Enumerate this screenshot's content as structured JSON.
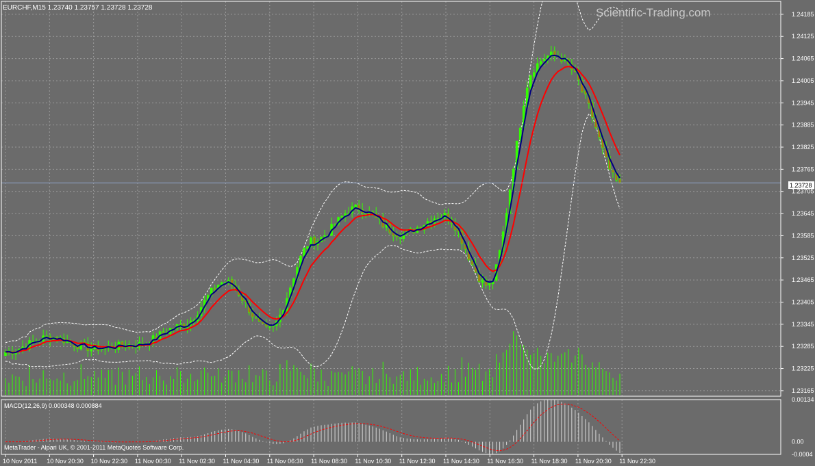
{
  "header": {
    "symbol_info": "EURCHF,M15  1.23740 1.23757 1.23728 1.23728",
    "watermark": "Scientific-Trading.com"
  },
  "macd": {
    "label": "MACD(12,26,9) 0.000348 0.000884"
  },
  "footer": {
    "copyright": "MetaTrader - Alpari UK, © 2001-2011 MetaQuotes Software Corp."
  },
  "colors": {
    "background": "#6b6b6b",
    "grid": "#999999",
    "bull_candle": "#33ff00",
    "bear_candle": "#b5651d",
    "ema_fast": "#000080",
    "ema_slow": "#ff0000",
    "bollinger": "#ffffff",
    "macd_signal": "#ff0000",
    "price_line": "#8ea2c6"
  },
  "chart_data": [
    {
      "type": "candlestick",
      "title": "EURCHF,M15",
      "current_price": "1.23728",
      "ohlc": [
        "1.23740",
        "1.23757",
        "1.23728",
        "1.23728"
      ],
      "y_ticks": [
        "1.24185",
        "1.24125",
        "1.24065",
        "1.24005",
        "1.23945",
        "1.23885",
        "1.23825",
        "1.23765",
        "1.23705",
        "1.23645",
        "1.23585",
        "1.23525",
        "1.23465",
        "1.23405",
        "1.23345",
        "1.23285",
        "1.23225",
        "1.23165"
      ],
      "ylim": [
        1.2315,
        1.2422
      ],
      "x_ticks": [
        "10 Nov 2011",
        "10 Nov 20:30",
        "10 Nov 22:30",
        "11 Nov 00:30",
        "11 Nov 02:30",
        "11 Nov 04:30",
        "11 Nov 06:30",
        "11 Nov 08:30",
        "11 Nov 10:30",
        "11 Nov 12:30",
        "11 Nov 14:30",
        "11 Nov 16:30",
        "11 Nov 18:30",
        "11 Nov 20:30",
        "11 Nov 22:30"
      ],
      "indicators": [
        "EMA fast (navy)",
        "EMA slow (red)",
        "Bollinger Bands (white dotted)",
        "Volume (green bars)"
      ],
      "key_points": [
        {
          "label": "10 Nov 2011",
          "close": 1.2327
        },
        {
          "label": "10 Nov 20:30",
          "close": 1.2331
        },
        {
          "label": "10 Nov 22:30",
          "close": 1.2328
        },
        {
          "label": "11 Nov 00:30",
          "close": 1.2329
        },
        {
          "label": "11 Nov 02:30",
          "close": 1.2334
        },
        {
          "label": "11 Nov 04:30",
          "close": 1.2346
        },
        {
          "label": "11 Nov 06:30",
          "close": 1.2333
        },
        {
          "label": "11 Nov 08:30",
          "close": 1.2357
        },
        {
          "label": "11 Nov 10:30",
          "close": 1.2366
        },
        {
          "label": "11 Nov 12:30",
          "close": 1.2359
        },
        {
          "label": "11 Nov 14:30",
          "close": 1.2364
        },
        {
          "label": "11 Nov 16:30",
          "close": 1.2345
        },
        {
          "label": "11 Nov 18:30",
          "close": 1.2398
        },
        {
          "label": "11 Nov 20:30",
          "close": 1.2399
        },
        {
          "label": "11 Nov 22:30",
          "close": 1.23728
        }
      ]
    },
    {
      "type": "bar",
      "title": "MACD(12,26,9)",
      "values_text": [
        "0.000348",
        "0.000884"
      ],
      "y_ticks": [
        "0.00134",
        "0.00",
        "-0.0004"
      ],
      "ylim": [
        -0.0004,
        0.00134
      ],
      "x_ticks_shared": true
    }
  ]
}
